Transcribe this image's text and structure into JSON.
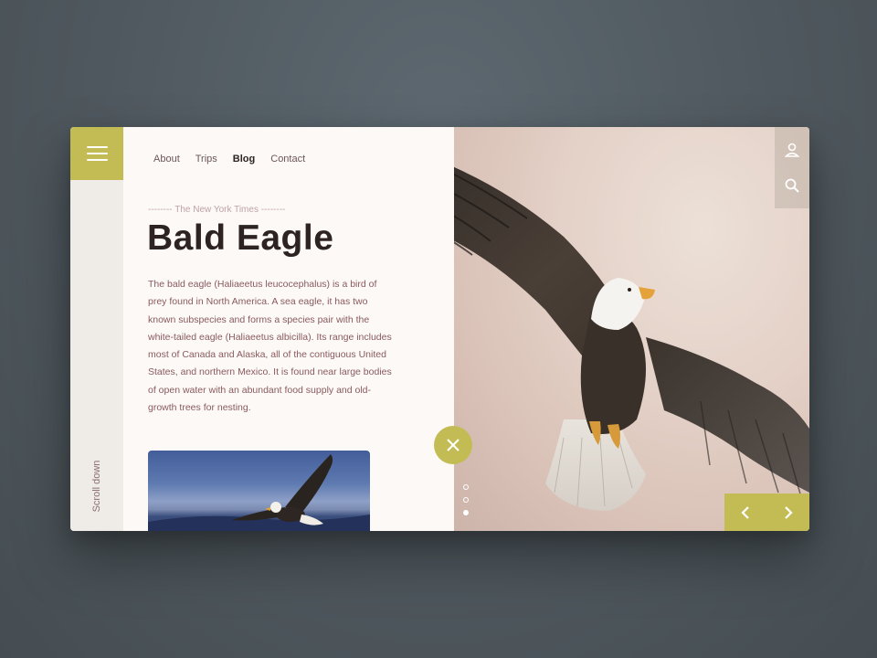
{
  "nav": {
    "items": [
      {
        "label": "About",
        "active": false
      },
      {
        "label": "Trips",
        "active": false
      },
      {
        "label": "Blog",
        "active": true
      },
      {
        "label": "Contact",
        "active": false
      }
    ]
  },
  "sidebar": {
    "scroll_label": "Scroll down"
  },
  "article": {
    "source": "-------- The New York Times --------",
    "title": "Bald Eagle",
    "description": "The bald eagle (Haliaeetus leucocephalus) is a bird of prey found in North America. A sea eagle, it has two known subspecies and forms a species pair with the white-tailed eagle (Haliaeetus albicilla). Its range includes most of Canada and Alaska, all of the contiguous United States, and northern Mexico. It is found near large bodies of open water with an abundant food supply and old-growth trees for nesting."
  },
  "icons": {
    "menu": "hamburger-menu-icon",
    "user": "user-icon",
    "search": "search-icon",
    "close": "close-icon",
    "prev": "chevron-left-icon",
    "next": "chevron-right-icon"
  },
  "slider": {
    "total": 3,
    "active_index": 2
  },
  "colors": {
    "accent": "#c3bc55",
    "title": "#2d2422",
    "body_text": "#8a5a5d",
    "source_text": "#c0a2a6",
    "panel_bg": "#fcf9f6",
    "sidebar_bg": "#efebe6"
  }
}
